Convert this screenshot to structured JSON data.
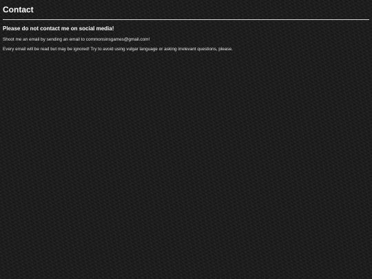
{
  "page": {
    "title": "Contact",
    "subheading": "Please do not contact me on social media!",
    "paragraphs": [
      "Shoot me an email by sending an email to commonsinsgames@gmail.com!",
      "Every email will be read but may be ignored! Try to avoid using vulgar language or asking irrelevant questions, please."
    ]
  },
  "colors": {
    "background": "#1c1c1c",
    "text": "#ffffff",
    "divider": "#d9d9d9"
  }
}
